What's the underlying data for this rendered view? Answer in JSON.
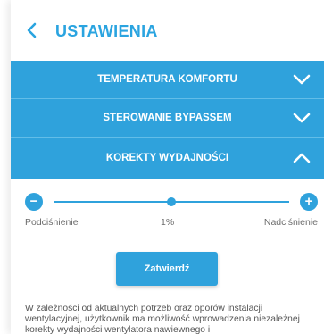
{
  "header": {
    "title": "USTAWIENIA",
    "back_icon": "chevron-left-icon"
  },
  "menu": {
    "items": [
      {
        "label": "TEMPERATURA KOMFORTU",
        "state": "collapsed",
        "icon": "chevron-down-icon"
      },
      {
        "label": "STEROWANIE BYPASSEM",
        "state": "collapsed",
        "icon": "chevron-down-icon"
      },
      {
        "label": "KOREKTY WYDAJNOŚCI",
        "state": "expanded",
        "icon": "chevron-up-icon"
      }
    ]
  },
  "correction": {
    "minus_label": "−",
    "plus_label": "+",
    "left_label": "Podciśnienie",
    "value_label": "1%",
    "right_label": "Nadciśnienie",
    "slider_position": 0.5,
    "confirm_label": "Zatwierdź",
    "description": "W zależności od aktualnych potrzeb oraz oporów instalacji wentylacyjnej, użytkownik ma możliwość wprowadzenia niezależnej korekty wydajności wentylatora nawiewnego i"
  },
  "colors": {
    "accent": "#2fa2dc",
    "title": "#2aa4e0",
    "background": "#ffffff"
  }
}
